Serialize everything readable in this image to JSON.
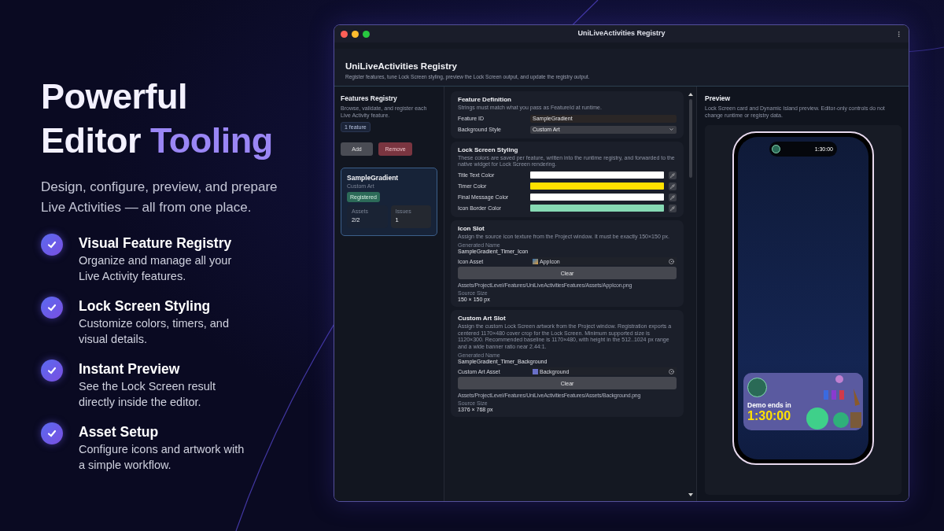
{
  "hero": {
    "title_line1": "Powerful",
    "title_line2": "Editor",
    "title_accent": "Tooling",
    "subtitle": "Design, configure, preview, and prepare Live Activities — all from one place.",
    "features": [
      {
        "title": "Visual Feature Registry",
        "description": "Organize and manage all your Live Activity features."
      },
      {
        "title": "Lock Screen Styling",
        "description": "Customize colors, timers, and visual details."
      },
      {
        "title": "Instant Preview",
        "description": "See the Lock Screen result directly inside the editor."
      },
      {
        "title": "Asset Setup",
        "description": "Configure icons and artwork with a simple workflow."
      }
    ]
  },
  "window": {
    "title": "UniLiveActivities Registry",
    "header_title": "UniLiveActivities Registry",
    "header_subtitle": "Register features, tune Lock Screen styling, preview the Lock Screen output, and update the registry output."
  },
  "sidebar": {
    "title": "Features Registry",
    "description": "Browse, validate, and register each Live Activity feature.",
    "count_badge": "1 feature",
    "buttons": [
      {
        "label": "Add",
        "kind": "neutral"
      },
      {
        "label": "Remove",
        "kind": "danger"
      }
    ],
    "cards": [
      {
        "name": "SampleGradient",
        "style": "Custom Art",
        "status": "Registered",
        "selected": true,
        "stats": [
          {
            "label": "Assets",
            "value": "2/2",
            "kind": "plain"
          },
          {
            "label": "Issues",
            "value": "1",
            "kind": "warn"
          }
        ]
      }
    ]
  },
  "feature_definition": {
    "title": "Feature Definition",
    "description": "Strings must match what you pass as FeatureId at runtime.",
    "fields": [
      {
        "label": "Feature ID",
        "value": "SampleGradient",
        "kind": "text"
      },
      {
        "label": "Background Style",
        "value": "Custom Art",
        "kind": "dropdown"
      }
    ]
  },
  "styling": {
    "title": "Lock Screen Styling",
    "description": "These colors are saved per feature, written into the runtime registry, and forwarded to the native widget for Lock Screen rendering.",
    "colors": [
      {
        "label": "Title Text Color",
        "color": "#ffffff"
      },
      {
        "label": "Timer Color",
        "color": "#ffe100"
      },
      {
        "label": "Final Message Color",
        "color": "#ffffff"
      },
      {
        "label": "Icon Border Color",
        "color": "#86d9b3"
      }
    ]
  },
  "slots": [
    {
      "title": "Icon Slot",
      "description": "Assign the source icon texture from the Project window. It must be exactly 150×150 px.",
      "generated_name_label": "Generated Name",
      "generated_name": "SampleGradient_Timer_Icon",
      "asset_label": "Icon Asset",
      "asset_name": "AppIcon",
      "clear_label": "Clear",
      "path": "Assets/ProjectLevel/Features/UniLiveActivitiesFeatures/Assets/AppIcon.png",
      "source_size_label": "Source Size",
      "source_size": "150 × 150 px"
    },
    {
      "title": "Custom Art Slot",
      "description": "Assign the custom Lock Screen artwork from the Project window. Registration exports a centered 1170×480 cover crop for the Lock Screen. Minimum supported size is 1120×300. Recommended baseline is 1170×480, with height in the 512..1024 px range and a wide banner ratio near 2.44:1.",
      "generated_name_label": "Generated Name",
      "generated_name": "SampleGradient_Timer_Background",
      "asset_label": "Custom Art Asset",
      "asset_name": "Background",
      "clear_label": "Clear",
      "path": "Assets/ProjectLevel/Features/UniLiveActivitiesFeatures/Assets/Background.png",
      "source_size_label": "Source Size",
      "source_size": "1376 × 768 px"
    }
  ],
  "preview": {
    "title": "Preview",
    "description": "Lock Screen card and Dynamic Island preview. Editor-only controls do not change runtime or registry data.",
    "island_time": "1:30:00",
    "card_message": "Demo ends in",
    "card_timer": "1:30:00"
  }
}
